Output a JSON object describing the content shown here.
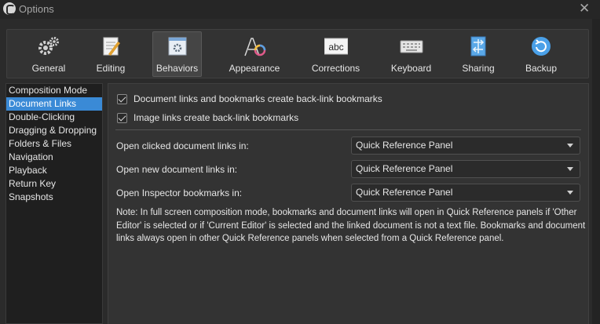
{
  "window": {
    "title": "Options",
    "close_icon": "close-icon"
  },
  "toolbar": {
    "items": [
      {
        "label": "General",
        "icon": "gears-icon",
        "active": false
      },
      {
        "label": "Editing",
        "icon": "pencil-paper-icon",
        "active": false
      },
      {
        "label": "Behaviors",
        "icon": "window-gear-icon",
        "active": true
      },
      {
        "label": "Appearance",
        "icon": "font-color-icon",
        "active": false
      },
      {
        "label": "Corrections",
        "icon": "abc-icon",
        "active": false
      },
      {
        "label": "Keyboard",
        "icon": "keyboard-icon",
        "active": false
      },
      {
        "label": "Sharing",
        "icon": "share-icon",
        "active": false
      },
      {
        "label": "Backup",
        "icon": "backup-icon",
        "active": false
      }
    ]
  },
  "sidebar": {
    "items": [
      {
        "label": "Composition Mode",
        "selected": false
      },
      {
        "label": "Document Links",
        "selected": true
      },
      {
        "label": "Double-Clicking",
        "selected": false
      },
      {
        "label": "Dragging & Dropping",
        "selected": false
      },
      {
        "label": "Folders & Files",
        "selected": false
      },
      {
        "label": "Navigation",
        "selected": false
      },
      {
        "label": "Playback",
        "selected": false
      },
      {
        "label": "Return Key",
        "selected": false
      },
      {
        "label": "Snapshots",
        "selected": false
      }
    ]
  },
  "main": {
    "checkboxes": [
      {
        "label": "Document links and bookmarks create back-link bookmarks",
        "checked": true
      },
      {
        "label": "Image links create back-link bookmarks",
        "checked": true
      }
    ],
    "options": [
      {
        "label": "Open clicked document links in:",
        "value": "Quick Reference Panel"
      },
      {
        "label": "Open new document links in:",
        "value": "Quick Reference Panel"
      },
      {
        "label": "Open Inspector bookmarks in:",
        "value": "Quick Reference Panel"
      }
    ],
    "note": "Note: In full screen composition mode, bookmarks and document links will open in Quick Reference panels if 'Other Editor' is selected or if 'Current Editor' is selected and the linked document is not a text file. Bookmarks and document links always open in other Quick Reference panels when selected from a Quick Reference panel."
  },
  "colors": {
    "accent": "#3a8ad6",
    "background": "#2b2b2b",
    "panel": "#333333"
  }
}
